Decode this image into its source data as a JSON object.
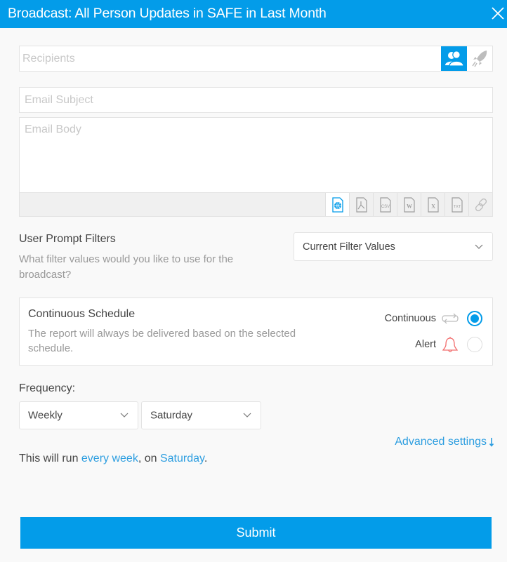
{
  "header": {
    "title": "Broadcast: All Person Updates in SAFE in Last Month",
    "close_icon": "close-icon"
  },
  "recipients": {
    "placeholder": "Recipients",
    "value": "",
    "buttons": [
      {
        "name": "users-icon",
        "active": true
      },
      {
        "name": "rocket-icon",
        "active": false
      }
    ]
  },
  "email": {
    "subject_placeholder": "Email Subject",
    "subject_value": "",
    "body_placeholder": "Email Body",
    "body_value": "",
    "attachments": [
      {
        "name": "html-file-icon",
        "label": "HTML",
        "active": true
      },
      {
        "name": "pdf-file-icon",
        "label": "PDF",
        "active": false
      },
      {
        "name": "csv-file-icon",
        "label": "CSV",
        "active": false
      },
      {
        "name": "word-file-icon",
        "label": "W",
        "active": false
      },
      {
        "name": "excel-file-icon",
        "label": "X",
        "active": false
      },
      {
        "name": "txt-file-icon",
        "label": "TXT",
        "active": false
      },
      {
        "name": "link-icon",
        "label": "Link",
        "active": false
      }
    ]
  },
  "filters": {
    "title": "User Prompt Filters",
    "description": "What filter values would you like to use for the broadcast?",
    "selected": "Current Filter Values"
  },
  "schedule": {
    "title": "Continuous Schedule",
    "description": "The report will always be delivered based on the selected schedule.",
    "options": [
      {
        "label": "Continuous",
        "icon": "repeat-icon",
        "checked": true
      },
      {
        "label": "Alert",
        "icon": "bell-icon",
        "checked": false
      }
    ]
  },
  "frequency": {
    "label": "Frequency:",
    "period": "Weekly",
    "day": "Saturday"
  },
  "advanced": {
    "label": "Advanced settings"
  },
  "summary": {
    "prefix": "This will run ",
    "period_text": "every week",
    "middle": ", on ",
    "day_text": "Saturday",
    "suffix": "."
  },
  "submit": {
    "label": "Submit"
  },
  "colors": {
    "accent": "#039ce9",
    "link": "#2d9ee0",
    "alert": "#f26d6d"
  }
}
